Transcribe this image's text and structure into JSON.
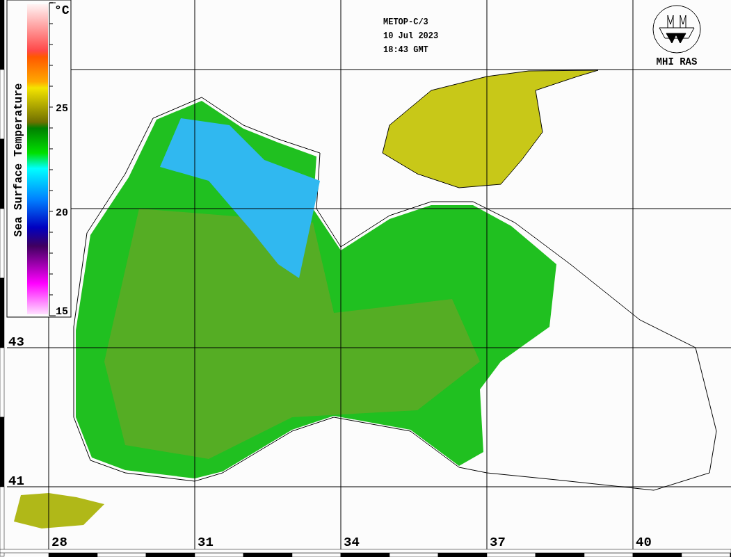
{
  "header": {
    "satellite": "METOP-C/3",
    "date": "10 Jul 2023",
    "time": "18:43 GMT"
  },
  "logo": {
    "text": "MHI RAS"
  },
  "colorbar": {
    "title": "Sea Surface Temperature",
    "unit": "°C",
    "ticks": [
      "25",
      "20",
      "15"
    ]
  },
  "latitude_labels": [
    "43",
    "41"
  ],
  "longitude_labels": [
    "28",
    "31",
    "34",
    "37",
    "40"
  ]
}
